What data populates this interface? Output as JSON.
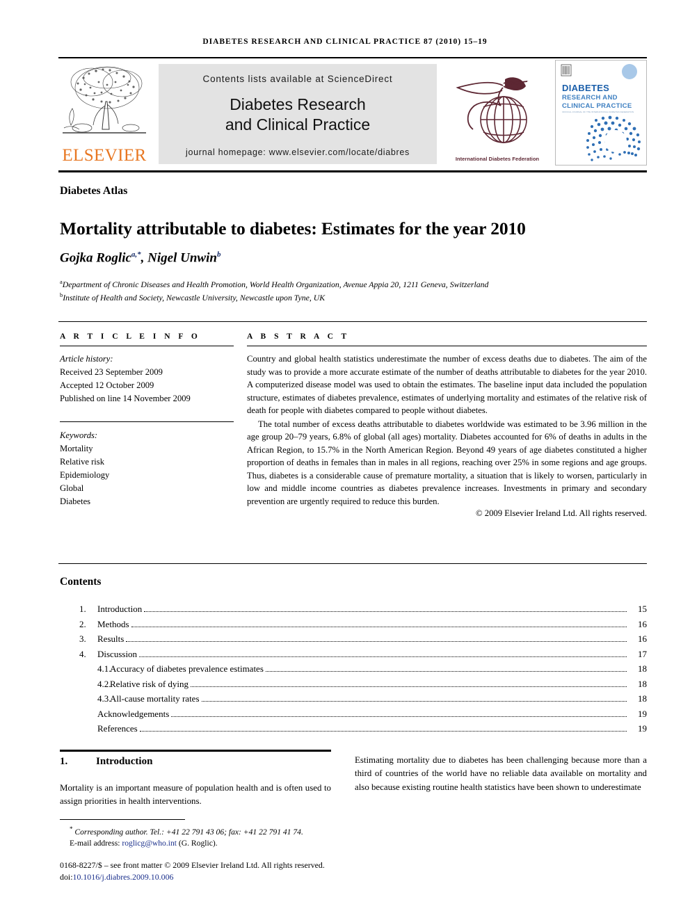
{
  "running_head": "Diabetes Research and Clinical Practice 87 (2010) 15–19",
  "masthead": {
    "elsevier_wordmark": "ELSEVIER",
    "contents_line": "Contents lists available at ScienceDirect",
    "journal_name_line1": "Diabetes Research",
    "journal_name_line2": "and Clinical Practice",
    "homepage_line": "journal homepage: www.elsevier.com/locate/diabres",
    "idf_caption": "International Diabetes Federation",
    "cover_title_line1": "DIABETES",
    "cover_title_line2": "RESEARCH AND",
    "cover_title_line3": "CLINICAL PRACTICE",
    "cover_subtitle": "OFFICIAL JOURNAL OF THE INTERNATIONAL DIABETES FEDERATION",
    "colors": {
      "elsevier_orange": "#E87722",
      "idf_maroon": "#5d2733",
      "cover_blue": "#1b5faa",
      "contents_bg": "#e3e3e3"
    }
  },
  "article": {
    "section_label": "Diabetes Atlas",
    "title": "Mortality attributable to diabetes: Estimates for the year 2010",
    "authors": "Gojka Roglic",
    "author_sup_1": "a,*",
    "authors_2": ", Nigel Unwin",
    "author_sup_2": "b",
    "affiliation_a_sup": "a",
    "affiliation_a": "Department of Chronic Diseases and Health Promotion, World Health Organization, Avenue Appia 20, 1211 Geneva, Switzerland",
    "affiliation_b_sup": "b",
    "affiliation_b": "Institute of Health and Society, Newcastle University, Newcastle upon Tyne, UK"
  },
  "article_info": {
    "heading": "A R T I C L E    I N F O",
    "history_title": "Article history:",
    "history": [
      "Received 23 September 2009",
      "Accepted 12 October 2009",
      "Published on line 14 November 2009"
    ],
    "keywords_title": "Keywords:",
    "keywords": [
      "Mortality",
      "Relative risk",
      "Epidemiology",
      "Global",
      "Diabetes"
    ]
  },
  "abstract": {
    "heading": "A B S T R A C T",
    "paragraph_1": "Country and global health statistics underestimate the number of excess deaths due to diabetes. The aim of the study was to provide a more accurate estimate of the number of deaths attributable to diabetes for the year 2010. A computerized disease model was used to obtain the estimates. The baseline input data included the population structure, estimates of diabetes prevalence, estimates of underlying mortality and estimates of the relative risk of death for people with diabetes compared to people without diabetes.",
    "paragraph_2": "The total number of excess deaths attributable to diabetes worldwide was estimated to be 3.96 million in the age group 20–79 years, 6.8% of global (all ages) mortality. Diabetes accounted for 6% of deaths in adults in the African Region, to 15.7% in the North American Region. Beyond 49 years of age diabetes constituted a higher proportion of deaths in females than in males in all regions, reaching over 25% in some regions and age groups. Thus, diabetes is a considerable cause of premature mortality, a situation that is likely to worsen, particularly in low and middle income countries as diabetes prevalence increases. Investments in primary and secondary prevention are urgently required to reduce this burden.",
    "copyright": "© 2009 Elsevier Ireland Ltd. All rights reserved."
  },
  "contents": {
    "heading": "Contents",
    "entries": [
      {
        "number": "1.",
        "label": "Introduction",
        "page": "15",
        "sub": false
      },
      {
        "number": "2.",
        "label": "Methods",
        "page": "16",
        "sub": false
      },
      {
        "number": "3.",
        "label": "Results",
        "page": "16",
        "sub": false
      },
      {
        "number": "4.",
        "label": "Discussion",
        "page": "17",
        "sub": false
      },
      {
        "number": "4.1.",
        "label": "Accuracy of diabetes prevalence estimates",
        "page": "18",
        "sub": true
      },
      {
        "number": "4.2.",
        "label": "Relative risk of dying",
        "page": "18",
        "sub": true
      },
      {
        "number": "4.3.",
        "label": "All-cause mortality rates",
        "page": "18",
        "sub": true
      },
      {
        "number": "",
        "label": "Acknowledgements",
        "page": "19",
        "sub": false
      },
      {
        "number": "",
        "label": "References",
        "page": "19",
        "sub": false
      }
    ]
  },
  "body": {
    "section_number": "1.",
    "section_title": "Introduction",
    "left_column": "Mortality is an important measure of population health and is often used to assign priorities in health interventions.",
    "right_column": "Estimating mortality due to diabetes has been challenging because more than a third of countries of the world have no reliable data available on mortality and also because existing routine health statistics have been shown to underestimate"
  },
  "footer": {
    "corresponding_star": "*",
    "corresponding_author": "Corresponding author. Tel.: +41 22 791 43 06; fax: +41 22 791 41 74.",
    "email_label": "E-mail address:",
    "email": "roglicg@who.int",
    "email_owner": "(G. Roglic).",
    "issn_line": "0168-8227/$ – see front matter © 2009 Elsevier Ireland Ltd. All rights reserved.",
    "doi_prefix": "doi:",
    "doi": "10.1016/j.diabres.2009.10.006"
  }
}
